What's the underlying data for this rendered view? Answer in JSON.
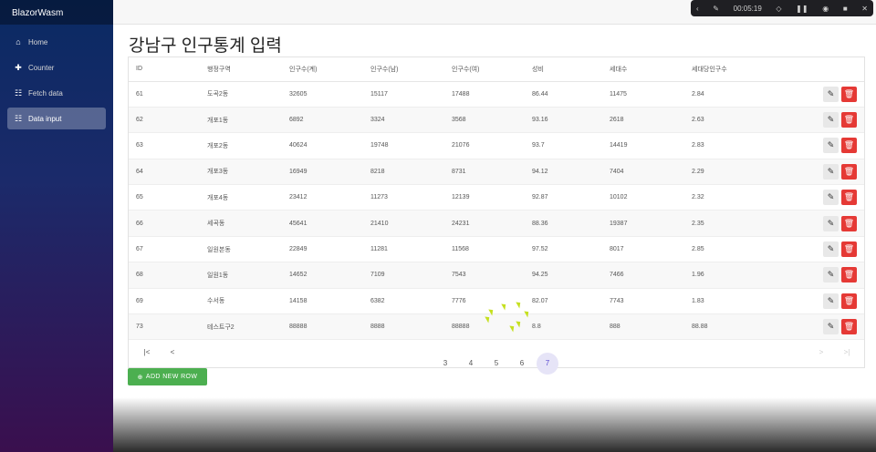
{
  "app": {
    "brand": "BlazorWasm",
    "title": "강남구 인구통계 입력"
  },
  "nav": [
    {
      "label": "Home",
      "icon": "home-icon"
    },
    {
      "label": "Counter",
      "icon": "plus-icon"
    },
    {
      "label": "Fetch data",
      "icon": "list-icon"
    },
    {
      "label": "Data input",
      "icon": "list-icon",
      "active": true
    }
  ],
  "recorder": {
    "time": "00:05:19"
  },
  "table": {
    "headers": [
      "ID",
      "행정구역",
      "인구수(계)",
      "인구수(남)",
      "인구수(여)",
      "성비",
      "세대수",
      "세대당인구수"
    ],
    "rows": [
      [
        "61",
        "도곡2동",
        "32605",
        "15117",
        "17488",
        "86.44",
        "11475",
        "2.84"
      ],
      [
        "62",
        "개포1동",
        "6892",
        "3324",
        "3568",
        "93.16",
        "2618",
        "2.63"
      ],
      [
        "63",
        "개포2동",
        "40624",
        "19748",
        "21076",
        "93.7",
        "14419",
        "2.83"
      ],
      [
        "64",
        "개포3동",
        "16949",
        "8218",
        "8731",
        "94.12",
        "7404",
        "2.29"
      ],
      [
        "65",
        "개포4동",
        "23412",
        "11273",
        "12139",
        "92.87",
        "10102",
        "2.32"
      ],
      [
        "66",
        "세곡동",
        "45641",
        "21410",
        "24231",
        "88.36",
        "19387",
        "2.35"
      ],
      [
        "67",
        "일원본동",
        "22849",
        "11281",
        "11568",
        "97.52",
        "8017",
        "2.85"
      ],
      [
        "68",
        "일원1동",
        "14652",
        "7109",
        "7543",
        "94.25",
        "7466",
        "1.96"
      ],
      [
        "69",
        "수서동",
        "14158",
        "6382",
        "7776",
        "82.07",
        "7743",
        "1.83"
      ],
      [
        "73",
        "테스트구2",
        "88888",
        "8888",
        "88888",
        "8.8",
        "888",
        "88.88"
      ]
    ]
  },
  "pager": {
    "pages": [
      "3",
      "4",
      "5",
      "6",
      "7"
    ],
    "current": "7",
    "first": "|<",
    "prev": "<",
    "next": ">",
    "last": ">|"
  },
  "add_button": "ADD NEW ROW"
}
